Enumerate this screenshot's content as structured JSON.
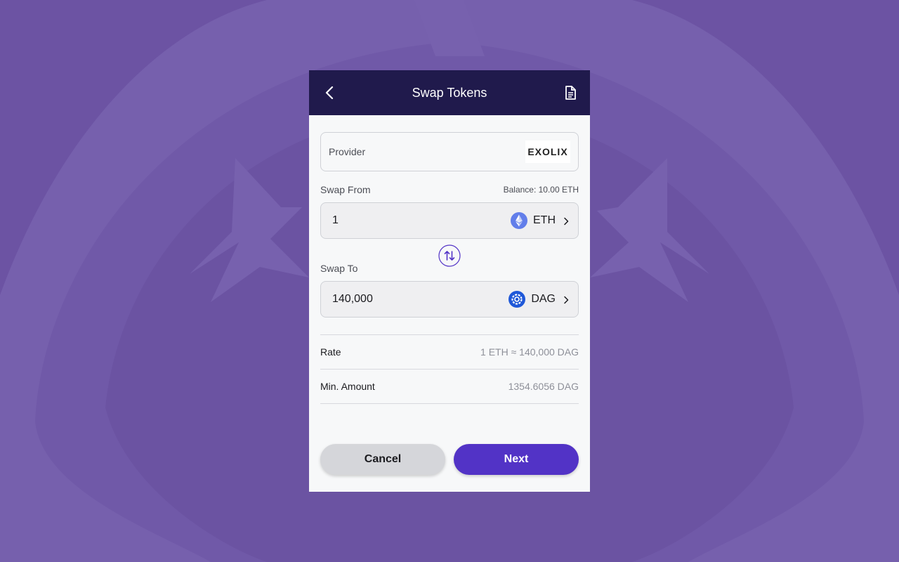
{
  "colors": {
    "background": "#6c53a3",
    "header": "#201a4c",
    "primary": "#5233c6",
    "eth": "#627eea",
    "dag": "#1f58d8"
  },
  "header": {
    "title": "Swap Tokens",
    "back_icon": "chevron-left-icon",
    "history_icon": "document-icon"
  },
  "provider": {
    "label": "Provider",
    "name": "EXOLIX"
  },
  "swap_from": {
    "label": "Swap From",
    "balance": "Balance: 10.00 ETH",
    "amount": "1",
    "token": "ETH",
    "token_icon": "ethereum-icon"
  },
  "swap_to": {
    "label": "Swap To",
    "amount": "140,000",
    "token": "DAG",
    "token_icon": "constellation-icon"
  },
  "details": {
    "rate_label": "Rate",
    "rate_value": "1 ETH ≈ 140,000 DAG",
    "min_label": "Min. Amount",
    "min_value": "1354.6056 DAG"
  },
  "actions": {
    "cancel": "Cancel",
    "next": "Next"
  }
}
